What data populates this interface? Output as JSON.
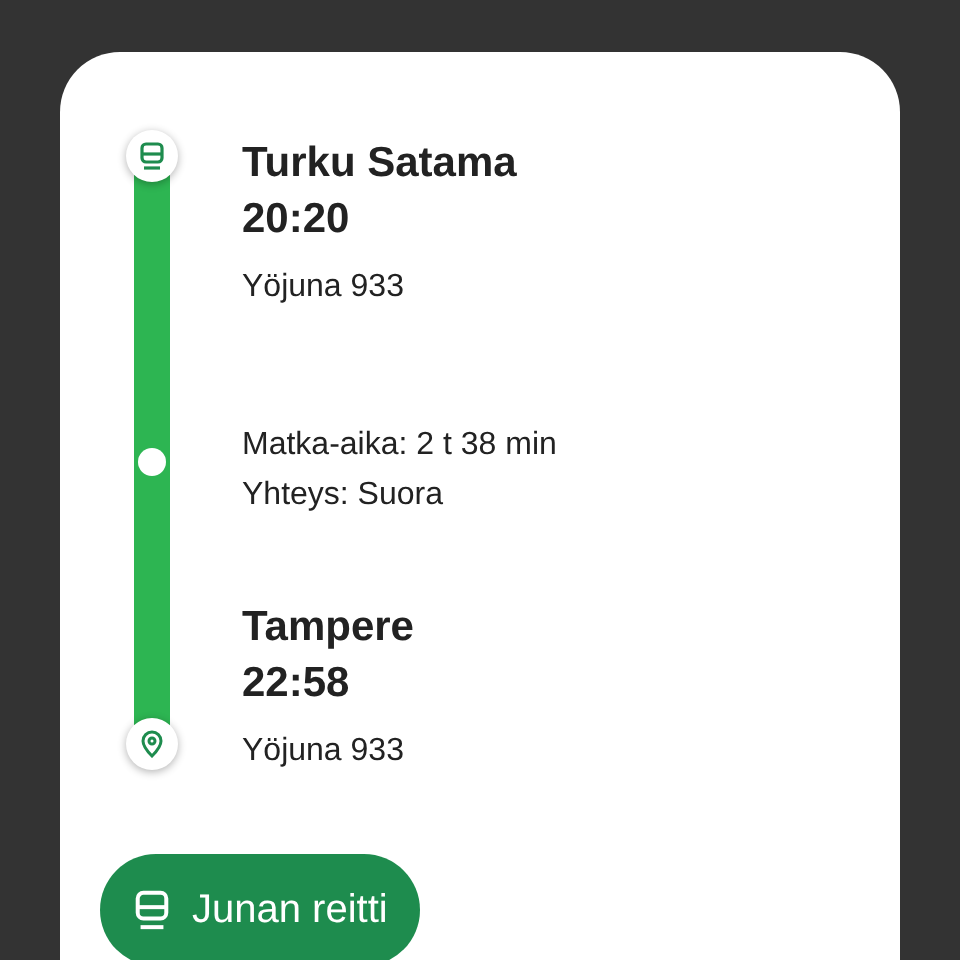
{
  "departure": {
    "station": "Turku Satama",
    "time": "20:20",
    "train": "Yöjuna 933"
  },
  "journey": {
    "duration": "Matka-aika: 2 t 38 min",
    "connection": "Yhteys: Suora"
  },
  "arrival": {
    "station": "Tampere",
    "time": "22:58",
    "train": "Yöjuna 933"
  },
  "button": {
    "label": "Junan reitti"
  }
}
